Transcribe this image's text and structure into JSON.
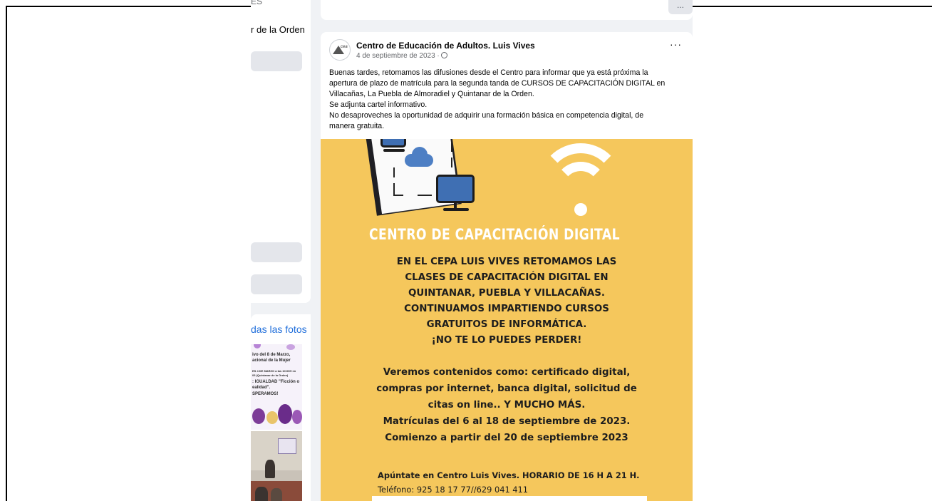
{
  "left_column": {
    "cut_header": "ES",
    "intro_text": "r de la Orden",
    "photos_link": "das las fotos",
    "thumb1_lines": [
      "ivo del 8 de Marzo,",
      "acional de la Mujer",
      "ES 4 DE MARZO  a las 10:00H en",
      "03 (Quintanar de la Orden)",
      ": IGUALDAD \"Ficción o",
      "ealidad\".",
      "SPERAMOS!"
    ]
  },
  "post": {
    "top_more": "...",
    "page_name": "Centro de Educación de Adultos. Luis Vives",
    "avatar_text": "cea",
    "date": "4 de septiembre de 2023 ·",
    "more": "···",
    "text_lines": [
      "Buenas tardes, retomamos las difusiones desde  el Centro para informar que ya está próxima la",
      "apertura de plazo de matrícula para la segunda tanda de CURSOS DE CAPACITACIÓN DIGITAL en",
      "Villacañas, La Puebla de Almoradiel y Quintanar de la Orden.",
      "Se adjunta cartel informativo.",
      "No desaproveches la oportunidad de adquirir una formación básica en competencia digital, de",
      "manera gratuita."
    ]
  },
  "poster": {
    "title": "CENTRO DE CAPACITACIÓN DIGITAL",
    "para1": [
      "EN EL CEPA LUIS VIVES RETOMAMOS LAS",
      "CLASES DE CAPACITACIÓN DIGITAL EN",
      "QUINTANAR, PUEBLA Y VILLACAÑAS.",
      "CONTINUAMOS IMPARTIENDO  CURSOS",
      "GRATUITOS DE INFORMÁTICA.",
      "¡NO TE LO PUEDES PERDER!"
    ],
    "para2": [
      "Veremos contenidos como: certificado digital,",
      "compras por internet, banca digital, solicitud de",
      "citas on line.. Y MUCHO MÁS.",
      "Matrículas del 6 al 18 de septiembre de 2023.",
      "Comienzo a partir del 20 de septiembre 2023"
    ],
    "contact_line1": "Apúntate en Centro Luis Vives. HORARIO DE 16 H A 21 H.",
    "contact_line2": "Teléfono: 925 18 17 77//629 041 411"
  },
  "colors": {
    "poster_bg": "#f5c75c",
    "link": "#216fdb",
    "page_bg": "#f0f2f5"
  }
}
